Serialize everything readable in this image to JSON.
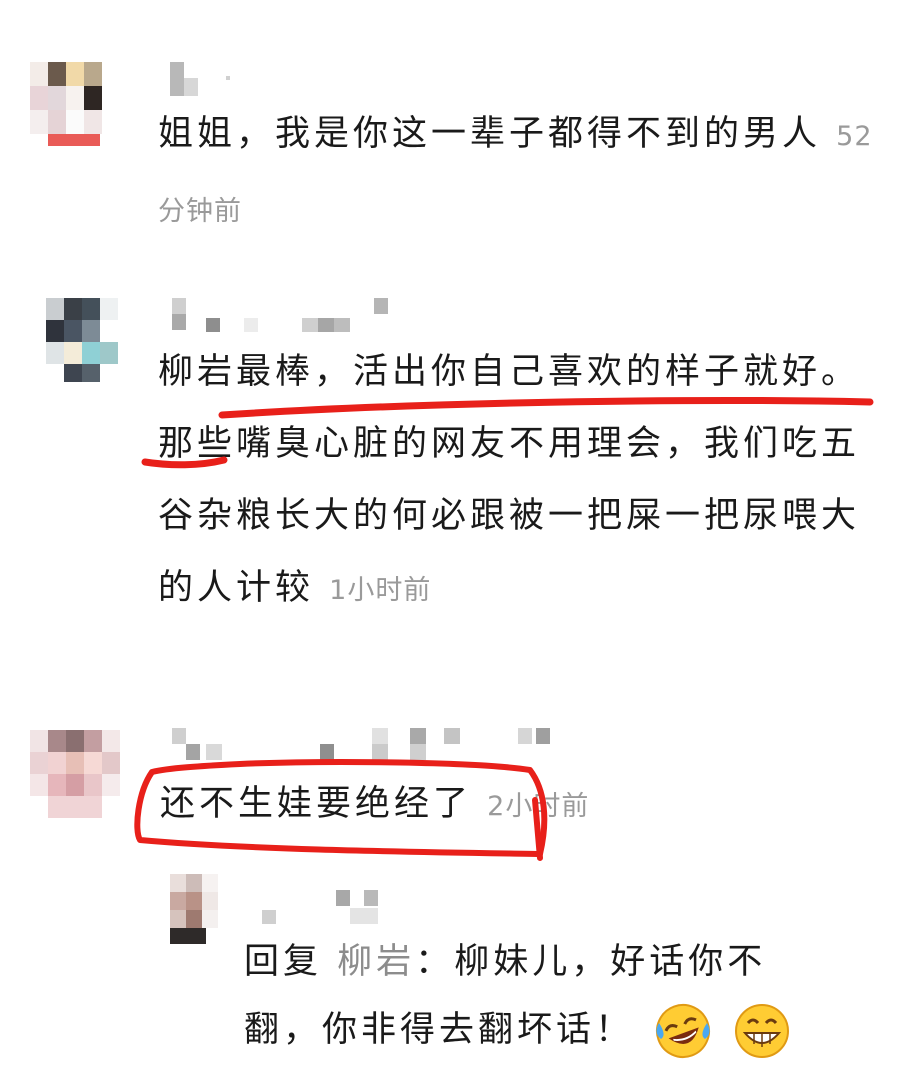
{
  "comments": [
    {
      "text": "姐姐，我是你这一辈子都得不到的男人",
      "time": "52分钟前"
    },
    {
      "text_highlight": "柳岩最棒，活出你自己喜欢的样子就好。",
      "text_rest": "那些嘴臭心脏的网友不用理会，我们吃五谷杂粮长大的何必跟被一把屎一把尿喂大的人计较",
      "time": "1小时前"
    },
    {
      "text": "还不生娃要绝经了",
      "time": "2小时前"
    }
  ],
  "reply": {
    "prefix": "回复",
    "target": "柳岩",
    "colon": "：",
    "text": "柳妹儿，好话你不翻，你非得去翻坏话！",
    "emojis": [
      "face-with-tears-of-joy-icon",
      "grinning-face-icon"
    ]
  },
  "colors": {
    "annotation_red": "#e8201a",
    "timestamp_gray": "#9a9a9a"
  }
}
